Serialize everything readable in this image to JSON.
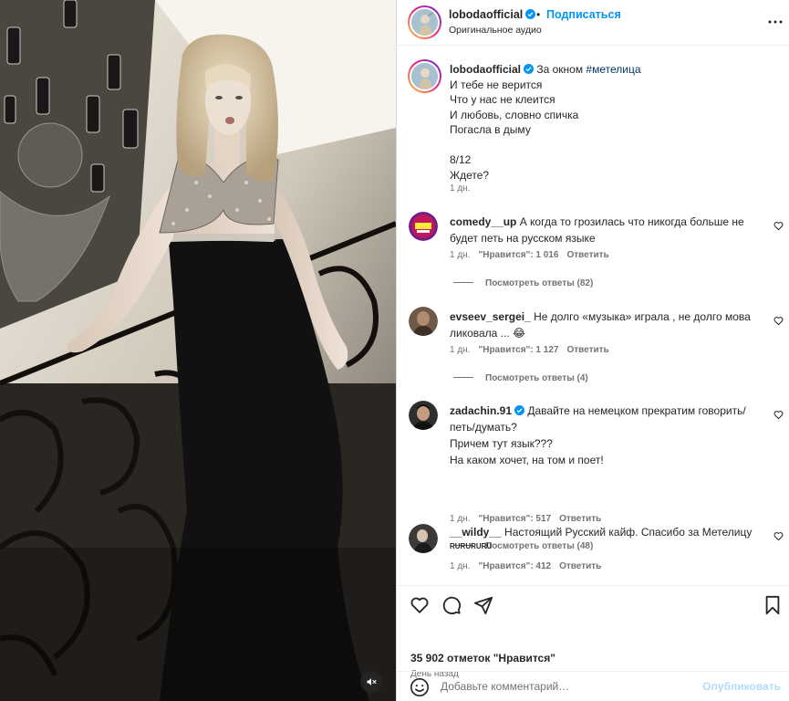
{
  "post": {
    "username": "lobodaofficial",
    "follow_label": "Подписаться",
    "dot": "•",
    "audio": "Оригинальное аудио",
    "caption": {
      "username": "lobodaofficial",
      "text_before_tag": "За окном",
      "hashtag": "#метелица",
      "body": "И тебе не верится\nЧто у нас не клеится\nИ любовь, словно спичка\nПогасла в дыму\n\n8/12\nЖдете?",
      "time": "1 дн."
    },
    "likes": "35 902 отметок \"Нравится\"",
    "date": "День назад",
    "comment_placeholder": "Добавьте комментарий…",
    "publish_label": "Опубликовать"
  },
  "comments": [
    {
      "username": "comedy__up",
      "text": "А когда то грозилась что никогда больше не будет петь на русском языке",
      "time": "1 дн.",
      "likes": "\"Нравится\": 1 016",
      "reply": "Ответить",
      "view_replies": "Посмотреть ответы (82)"
    },
    {
      "username": "evseev_sergei_",
      "text": "Не долго «музыка» играла , не долго мова ликовала ...",
      "emoji": "😂",
      "time": "1 дн.",
      "likes": "\"Нравится\": 1 127",
      "reply": "Ответить",
      "view_replies": "Посмотреть ответы (4)"
    },
    {
      "username": "zadachin.91",
      "text": "Давайте на немецком прекратим говорить/петь/думать?\nПричем тут язык???\nНа каком хочет, на том и поет!",
      "time": "1 дн.",
      "likes": "\"Нравится\": 517",
      "reply": "Ответить",
      "view_replies": "Посмотреть ответы (48)"
    },
    {
      "username": "__wildy__",
      "text": "Настоящий Русский кайф. Спасибо за Метелицу",
      "subtext": "RURURURU",
      "time": "1 дн.",
      "likes": "\"Нравится\": 412",
      "reply": "Ответить"
    }
  ],
  "colors": {
    "link_blue": "#0095f6",
    "hashtag": "#00376b",
    "muted": "#737373",
    "publish_disabled": "#b3dbff"
  },
  "icons": {
    "verified": "verified-badge-icon",
    "more": "more-options-icon",
    "like": "heart-icon",
    "comment": "comment-bubble-icon",
    "share": "paper-plane-icon",
    "save": "bookmark-icon",
    "emoji": "emoji-smile-icon",
    "mute": "speaker-muted-icon"
  }
}
